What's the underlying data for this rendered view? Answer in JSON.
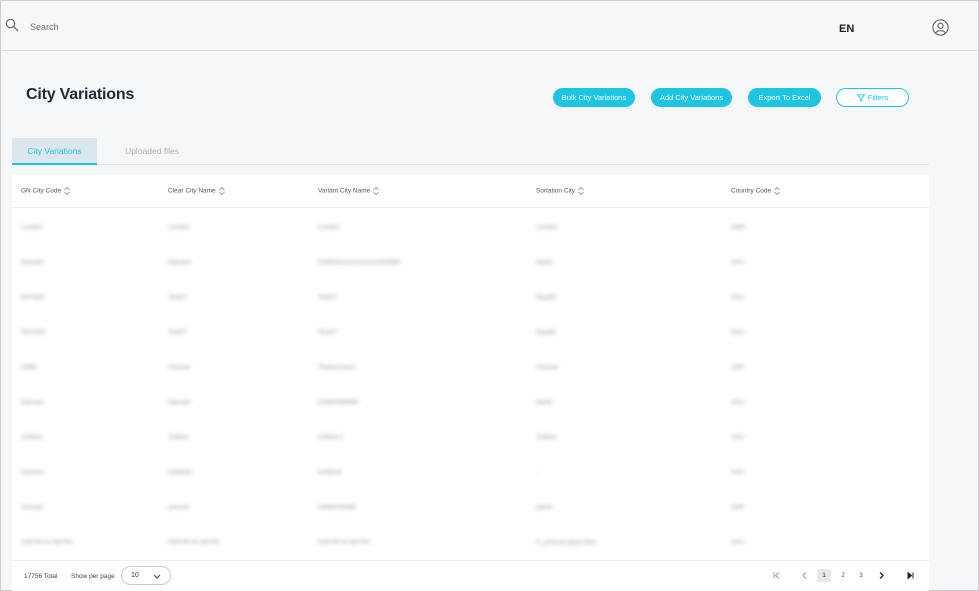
{
  "topbar": {
    "search_placeholder": "Search",
    "language": "EN"
  },
  "page": {
    "title": "City Variations"
  },
  "actions": {
    "bulk_label": "Bulk City Variations",
    "add_label": "Add City Variations",
    "export_label": "Export To Excel",
    "filters_label": "Filters"
  },
  "tabs": [
    {
      "label": "City Variations",
      "active": true
    },
    {
      "label": "Uploaded files",
      "active": false
    }
  ],
  "table": {
    "columns": [
      "GN City Code",
      "Clear City Name",
      "Variant City Name",
      "Sortation City",
      "Country Code"
    ],
    "rows": [
      [
        "London",
        "London",
        "London",
        "London",
        "GBR"
      ],
      [
        "Damam",
        "Damam",
        "DAMAmmmmmmmmDAMM",
        "damb",
        "SAU"
      ],
      [
        "RIYADH",
        "Test07",
        "Test07",
        "Riyadh",
        "SAU"
      ],
      [
        "RIYADH",
        "Test07",
        "Test07",
        "Riyadh",
        "SAU"
      ],
      [
        "AMM",
        "Amman",
        "Testamman2",
        "Amman",
        "JOR"
      ],
      [
        "Damam",
        "Damam",
        "DAMAMMMM",
        "damb",
        "SAU"
      ],
      [
        "JUBAIL",
        "JUBAIL",
        "JUBAIL1",
        "JUBAIL",
        "SAU"
      ],
      [
        "Damam",
        "DAMAN",
        "DAMAN",
        "-",
        "SAU"
      ],
      [
        "Amman",
        "amman",
        "AMMANNNB",
        "damb",
        "JOR"
      ],
      [
        "HAFAR AL BATIN",
        "HAFAR AL BATIN",
        "HAFAR AL BATIN",
        "S_prod pe guya fiied",
        "SAU"
      ]
    ]
  },
  "footer": {
    "total": "17756 Total",
    "per_page_label": "Show per page",
    "per_page_value": "10",
    "pages": [
      "1",
      "2",
      "3"
    ],
    "current_page": "1"
  },
  "colors": {
    "accent": "#1ec5e3",
    "background": "#f6f7f9",
    "active_tab_bg": "#dbe7ef"
  }
}
